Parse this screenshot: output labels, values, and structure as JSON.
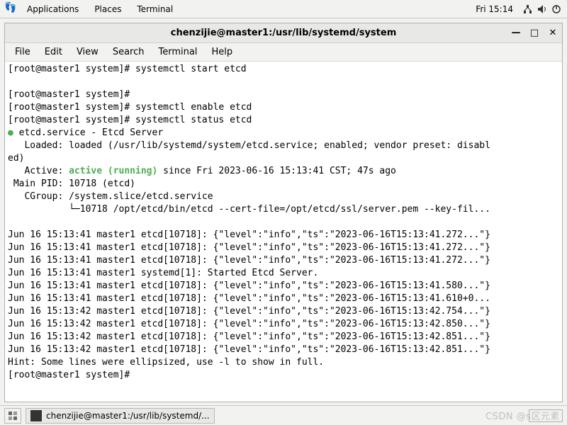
{
  "top_panel": {
    "applications": "Applications",
    "places": "Places",
    "app_name": "Terminal",
    "clock": "Fri 15:14",
    "network_icon": "network-icon",
    "volume_icon": "volume-icon",
    "power_icon": "power-icon"
  },
  "window": {
    "title": "chenzijie@master1:/usr/lib/systemd/system",
    "min": "—",
    "max": "□",
    "close": "✕"
  },
  "menubar": {
    "file": "File",
    "edit": "Edit",
    "view": "View",
    "search": "Search",
    "terminal": "Terminal",
    "help": "Help"
  },
  "terminal": {
    "prompt": "[root@master1 system]#",
    "cmd_start": "systemctl start etcd",
    "cmd_enable": "systemctl enable etcd",
    "cmd_status": "systemctl status etcd",
    "unit_line": " etcd.service - Etcd Server",
    "loaded_line": "   Loaded: loaded (/usr/lib/systemd/system/etcd.service; enabled; vendor preset: disabl",
    "loaded_line2": "ed)",
    "active_prefix": "   Active: ",
    "active_status": "active (running)",
    "active_suffix": " since Fri 2023-06-16 15:13:41 CST; 47s ago",
    "main_pid": " Main PID: 10718 (etcd)",
    "cgroup": "   CGroup: /system.slice/etcd.service",
    "cgroup_proc": "           └─10718 /opt/etcd/bin/etcd --cert-file=/opt/etcd/ssl/server.pem --key-fil...",
    "log_lines": [
      "Jun 16 15:13:41 master1 etcd[10718]: {\"level\":\"info\",\"ts\":\"2023-06-16T15:13:41.272...\"}",
      "Jun 16 15:13:41 master1 etcd[10718]: {\"level\":\"info\",\"ts\":\"2023-06-16T15:13:41.272...\"}",
      "Jun 16 15:13:41 master1 etcd[10718]: {\"level\":\"info\",\"ts\":\"2023-06-16T15:13:41.272...\"}",
      "Jun 16 15:13:41 master1 systemd[1]: Started Etcd Server.",
      "Jun 16 15:13:41 master1 etcd[10718]: {\"level\":\"info\",\"ts\":\"2023-06-16T15:13:41.580...\"}",
      "Jun 16 15:13:41 master1 etcd[10718]: {\"level\":\"info\",\"ts\":\"2023-06-16T15:13:41.610+0...",
      "Jun 16 15:13:42 master1 etcd[10718]: {\"level\":\"info\",\"ts\":\"2023-06-16T15:13:42.754...\"}",
      "Jun 16 15:13:42 master1 etcd[10718]: {\"level\":\"info\",\"ts\":\"2023-06-16T15:13:42.850...\"}",
      "Jun 16 15:13:42 master1 etcd[10718]: {\"level\":\"info\",\"ts\":\"2023-06-16T15:13:42.851...\"}",
      "Jun 16 15:13:42 master1 etcd[10718]: {\"level\":\"info\",\"ts\":\"2023-06-16T15:13:42.851...\"}"
    ],
    "hint": "Hint: Some lines were ellipsized, use -l to show in full."
  },
  "taskbar": {
    "task_label": "chenzijie@master1:/usr/lib/systemd/..."
  },
  "watermark": "CSDN @s区元素"
}
